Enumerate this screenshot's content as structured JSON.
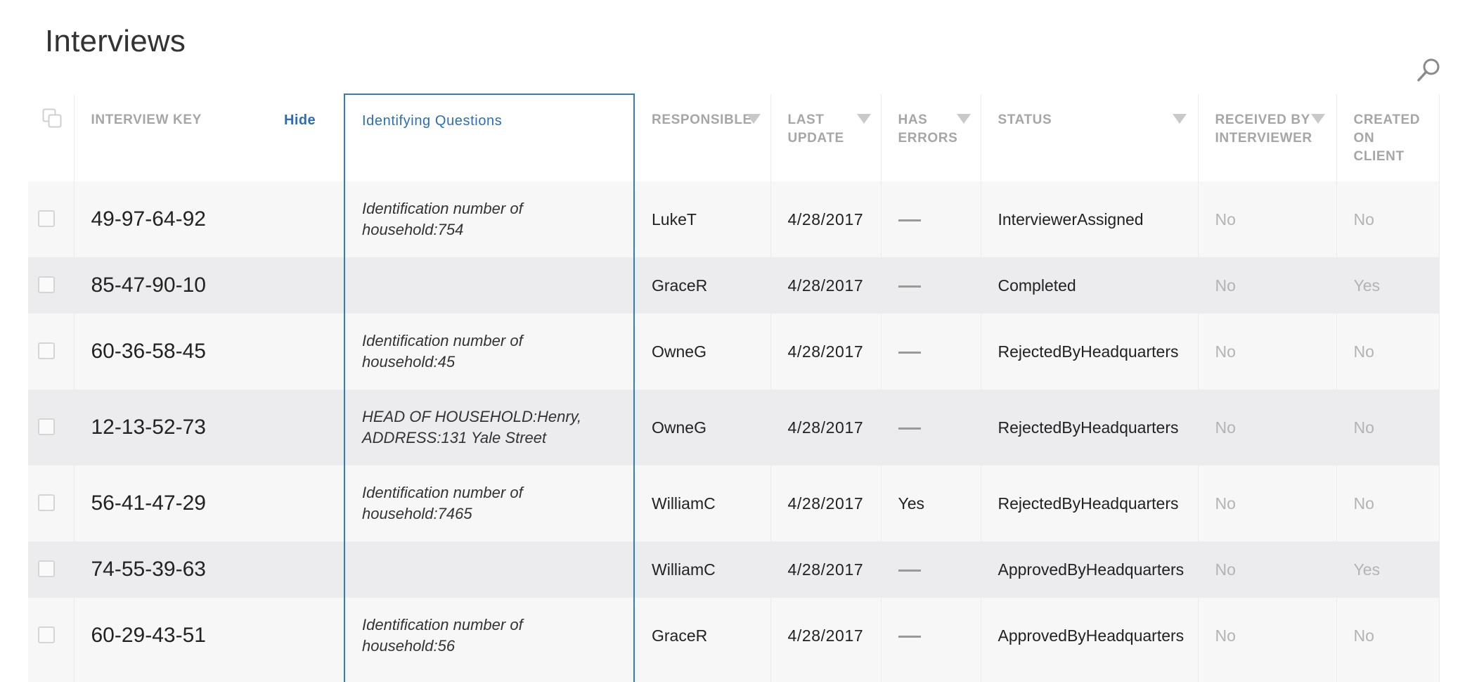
{
  "page": {
    "title": "Interviews"
  },
  "table": {
    "headers": {
      "interview_key": "INTERVIEW KEY",
      "hide": "Hide",
      "identifying_questions": "Identifying Questions",
      "responsible": "RESPONSIBLE",
      "last_update_1": "LAST",
      "last_update_2": "UPDATE",
      "has_errors_1": "HAS",
      "has_errors_2": "ERRORS",
      "status": "STATUS",
      "received_1": "RECEIVED BY",
      "received_2": "INTERVIEWER",
      "created_1": "CREATED",
      "created_2": "ON",
      "created_3": "CLIENT"
    },
    "rows": [
      {
        "key": "49-97-64-92",
        "idq1": "Identification number of",
        "idq2": "household:754",
        "responsible": "LukeT",
        "date": "4/28/2017",
        "errors": "—",
        "status": "InterviewerAssigned",
        "received": "No",
        "created": "No"
      },
      {
        "key": "85-47-90-10",
        "idq1": "",
        "idq2": "",
        "responsible": "GraceR",
        "date": "4/28/2017",
        "errors": "—",
        "status": "Completed",
        "received": "No",
        "created": "Yes"
      },
      {
        "key": "60-36-58-45",
        "idq1": "Identification number of",
        "idq2": "household:45",
        "responsible": "OwneG",
        "date": "4/28/2017",
        "errors": "—",
        "status": "RejectedByHeadquarters",
        "received": "No",
        "created": "No"
      },
      {
        "key": "12-13-52-73",
        "idq1": "HEAD OF HOUSEHOLD:Henry,",
        "idq2": "ADDRESS:131 Yale Street",
        "responsible": "OwneG",
        "date": "4/28/2017",
        "errors": "—",
        "status": "RejectedByHeadquarters",
        "received": "No",
        "created": "No"
      },
      {
        "key": "56-41-47-29",
        "idq1": "Identification number of",
        "idq2": "household:7465",
        "responsible": "WilliamC",
        "date": "4/28/2017",
        "errors": "Yes",
        "status": "RejectedByHeadquarters",
        "received": "No",
        "created": "No"
      },
      {
        "key": "74-55-39-63",
        "idq1": "",
        "idq2": "",
        "responsible": "WilliamC",
        "date": "4/28/2017",
        "errors": "—",
        "status": "ApprovedByHeadquarters",
        "received": "No",
        "created": "Yes"
      },
      {
        "key": "60-29-43-51",
        "idq1": "Identification number of",
        "idq2": "household:56",
        "responsible": "GraceR",
        "date": "4/28/2017",
        "errors": "—",
        "status": "ApprovedByHeadquarters",
        "received": "No",
        "created": "No"
      }
    ]
  },
  "icons": {
    "search": "search-icon",
    "select_all": "select-all-icon",
    "sort": "sort-triangle-icon",
    "no_errors": "dash-icon"
  },
  "colors": {
    "accent_blue": "#2a6ebb",
    "column_highlight": "#2f7ec4",
    "error_red": "#e0392a",
    "header_gray": "#a6a6a6"
  }
}
